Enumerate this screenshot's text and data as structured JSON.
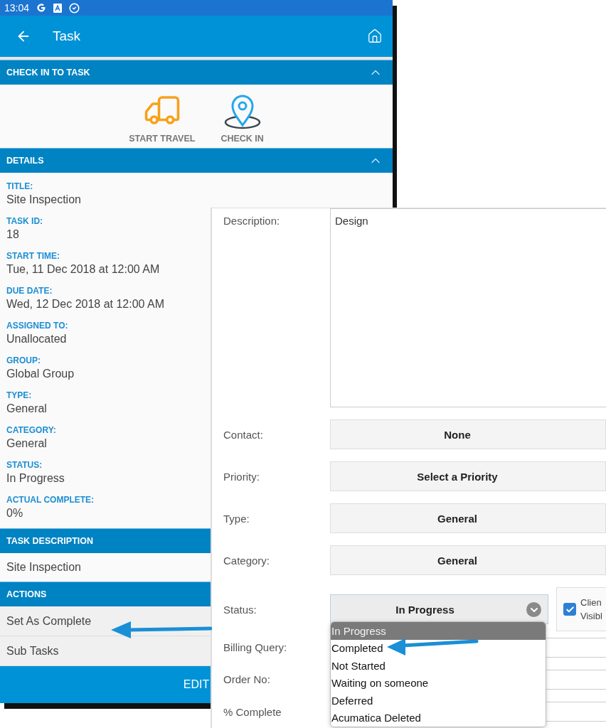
{
  "status_bar": {
    "time": "13:04"
  },
  "app_bar": {
    "title": "Task"
  },
  "check_in": {
    "header": "CHECK IN TO TASK",
    "expanded": true,
    "actions": [
      {
        "label": "START TRAVEL",
        "kind": "truck"
      },
      {
        "label": "CHECK IN",
        "kind": "pin"
      }
    ]
  },
  "details": {
    "header": "DETAILS",
    "expanded": true,
    "fields": [
      {
        "label": "TITLE:",
        "value": "Site Inspection"
      },
      {
        "label": "TASK ID:",
        "value": "18"
      },
      {
        "label": "START TIME:",
        "value": "Tue, 11 Dec 2018 at 12:00 AM"
      },
      {
        "label": "DUE DATE:",
        "value": "Wed, 12 Dec 2018 at 12:00 AM"
      },
      {
        "label": "ASSIGNED TO:",
        "value": "Unallocated"
      },
      {
        "label": "GROUP:",
        "value": "Global Group"
      },
      {
        "label": "TYPE:",
        "value": "General"
      },
      {
        "label": "CATEGORY:",
        "value": "General"
      },
      {
        "label": "STATUS:",
        "value": "In Progress"
      },
      {
        "label": "ACTUAL COMPLETE:",
        "value": "0%"
      }
    ]
  },
  "task_description": {
    "header": "TASK DESCRIPTION",
    "text": "Site Inspection"
  },
  "actions": {
    "header": "ACTIONS",
    "items": [
      "Set As Complete",
      "Sub Tasks"
    ]
  },
  "bottom_bar": {
    "button": "EDIT"
  },
  "form": {
    "description": {
      "label": "Description:",
      "value": "Design"
    },
    "selects": [
      {
        "label": "Contact:",
        "value": "None"
      },
      {
        "label": "Priority:",
        "value": "Select a Priority"
      },
      {
        "label": "Type:",
        "value": "General"
      },
      {
        "label": "Category:",
        "value": "General"
      }
    ],
    "status": {
      "label": "Status:",
      "value": "In Progress",
      "open": true,
      "options": [
        {
          "label": "In Progress",
          "selected": true
        },
        {
          "label": "Completed",
          "selected": false
        },
        {
          "label": "Not Started",
          "selected": false
        },
        {
          "label": "Waiting on someone",
          "selected": false
        },
        {
          "label": "Deferred",
          "selected": false
        },
        {
          "label": "Acumatica Deleted",
          "selected": false
        }
      ]
    },
    "client_visible": {
      "lines": [
        "Clien",
        "Visibl"
      ],
      "checked": true
    },
    "inputs": [
      {
        "label": "Billing Query:"
      },
      {
        "label": "Order No:"
      },
      {
        "label": "% Complete"
      }
    ]
  }
}
